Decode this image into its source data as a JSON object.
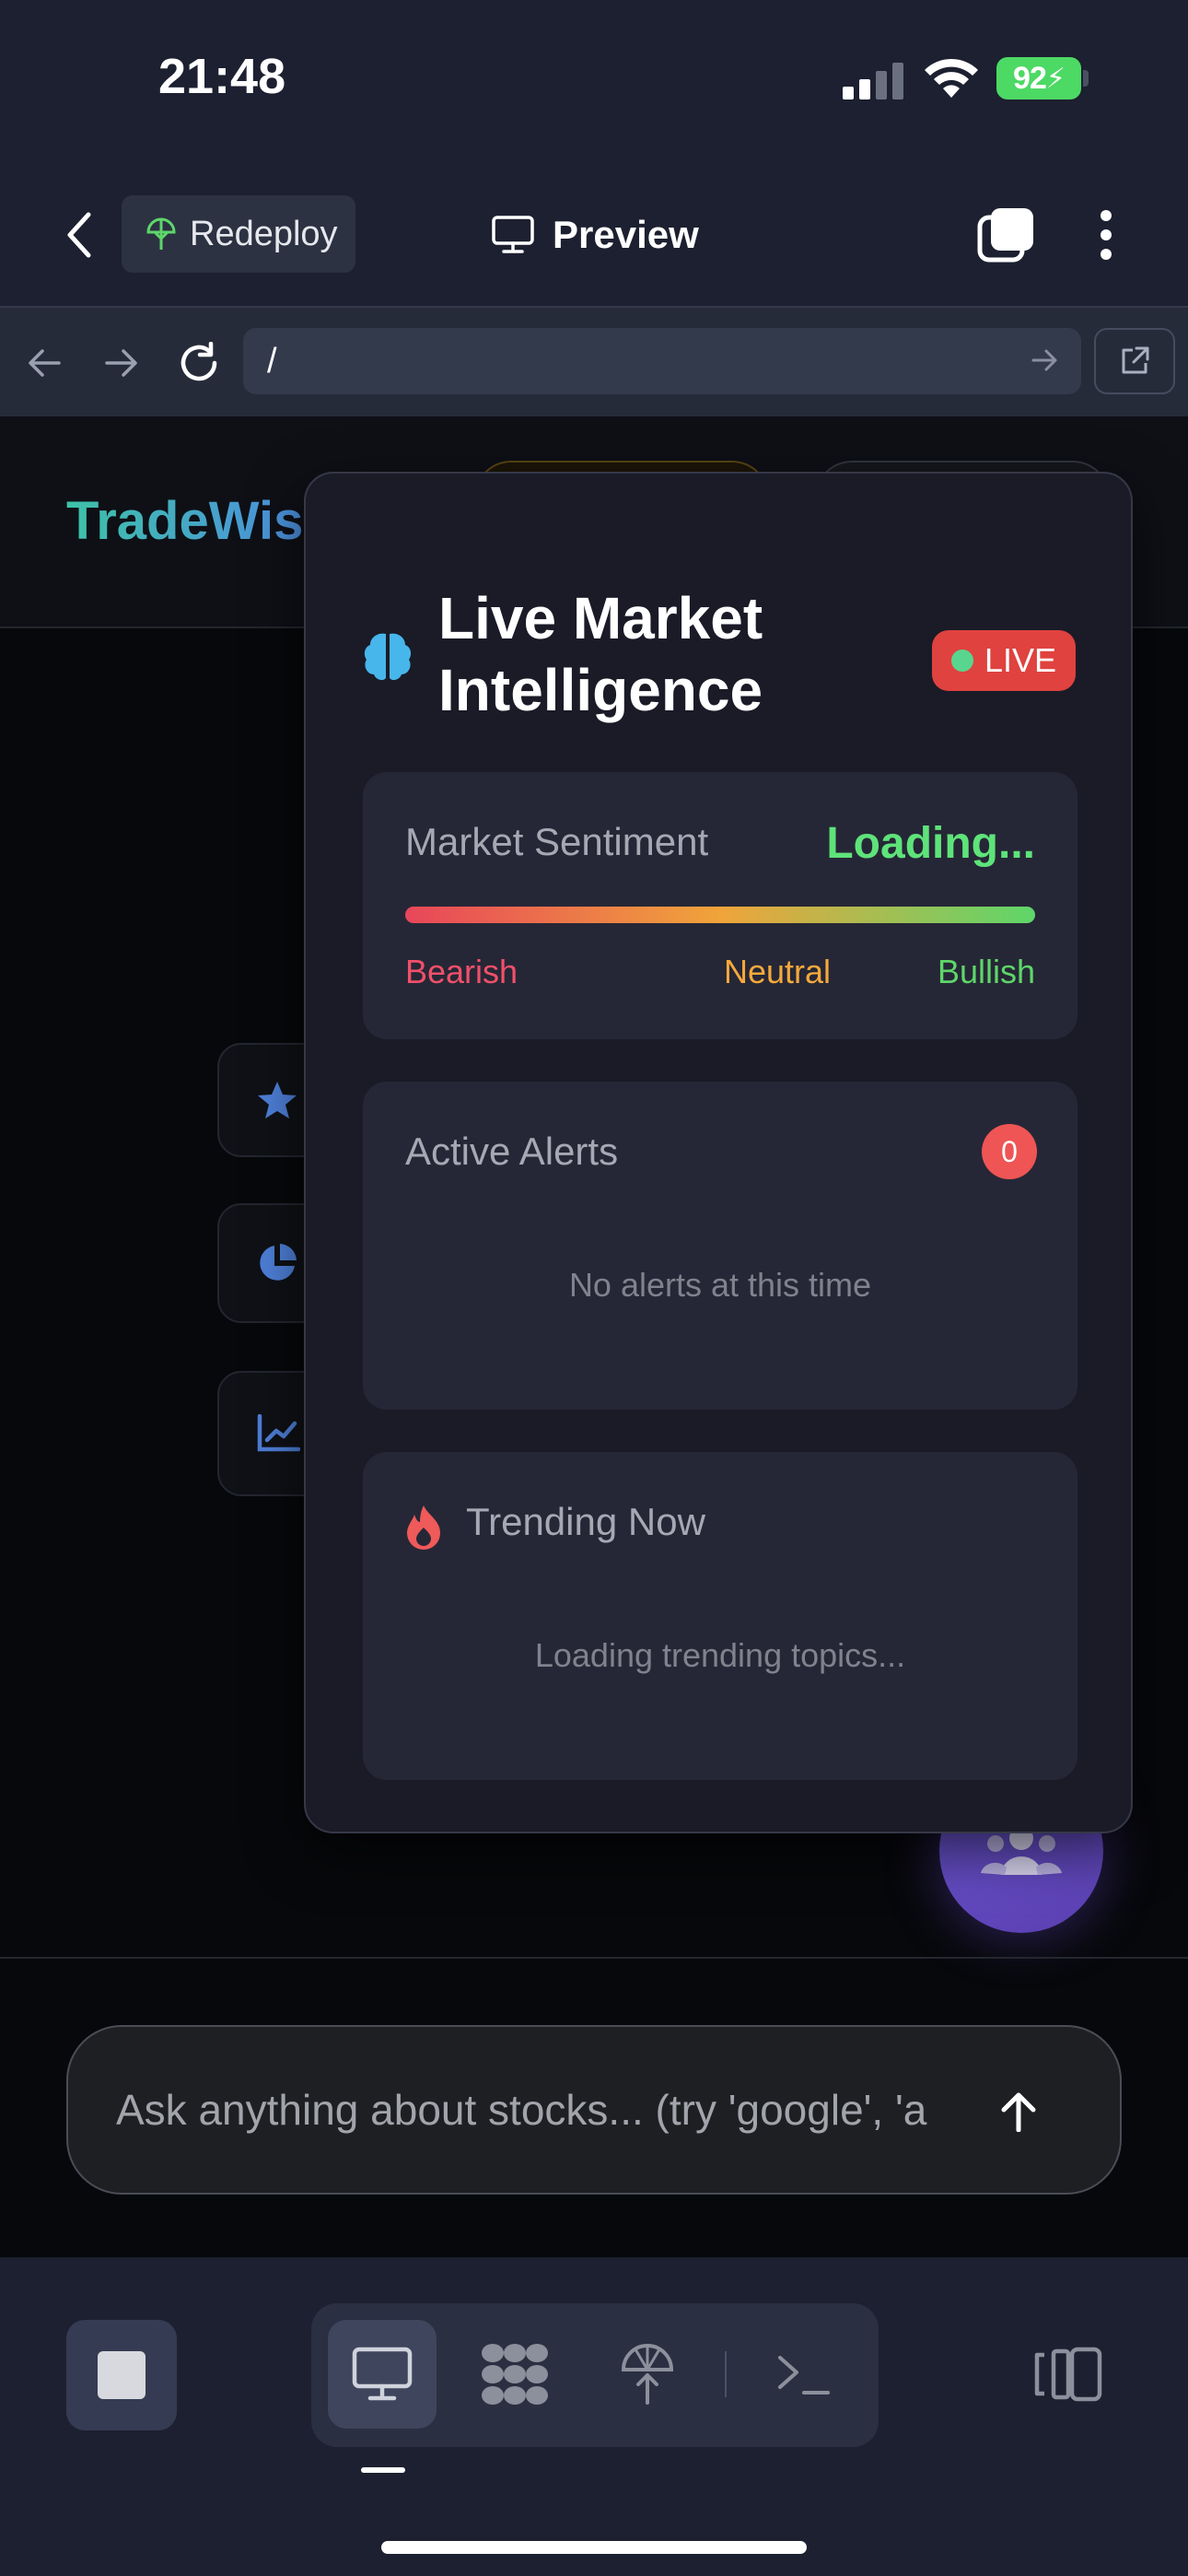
{
  "status_bar": {
    "time": "21:48",
    "battery": "92",
    "icons": [
      "signal-icon",
      "wifi-icon",
      "battery-icon"
    ]
  },
  "app_bar": {
    "redeploy_label": "Redeploy",
    "preview_label": "Preview",
    "icons": [
      "back-icon",
      "redeploy-icon",
      "monitor-icon",
      "tabs-icon",
      "more-icon"
    ]
  },
  "browser": {
    "url": "/",
    "icons": [
      "back-arrow-icon",
      "forward-arrow-icon",
      "reload-icon",
      "go-arrow-icon",
      "external-link-icon"
    ]
  },
  "site": {
    "brand": "TradeWis",
    "chat_placeholder": "Ask anything about stocks... (try 'google', 'a",
    "side_icons": [
      "star-icon",
      "pie-chart-icon",
      "line-chart-icon"
    ]
  },
  "panel": {
    "title": "Live Market Intelligence",
    "live_badge": "LIVE",
    "sentiment": {
      "label": "Market Sentiment",
      "value": "Loading...",
      "bearish": "Bearish",
      "neutral": "Neutral",
      "bullish": "Bullish"
    },
    "alerts": {
      "label": "Active Alerts",
      "count": "0",
      "empty": "No alerts at this time"
    },
    "trending": {
      "label": "Trending Now",
      "loading": "Loading trending topics..."
    }
  },
  "colors": {
    "accent_green": "#5ee37a",
    "live_red": "#e0423f",
    "brand_teal": "#3ec2a8",
    "fab_purple": "#6d59d6"
  },
  "bottom_bar": {
    "icons": [
      "stop-icon",
      "preview-mode-icon",
      "grid-mode-icon",
      "deploy-mode-icon",
      "terminal-mode-icon",
      "layout-icon"
    ]
  }
}
